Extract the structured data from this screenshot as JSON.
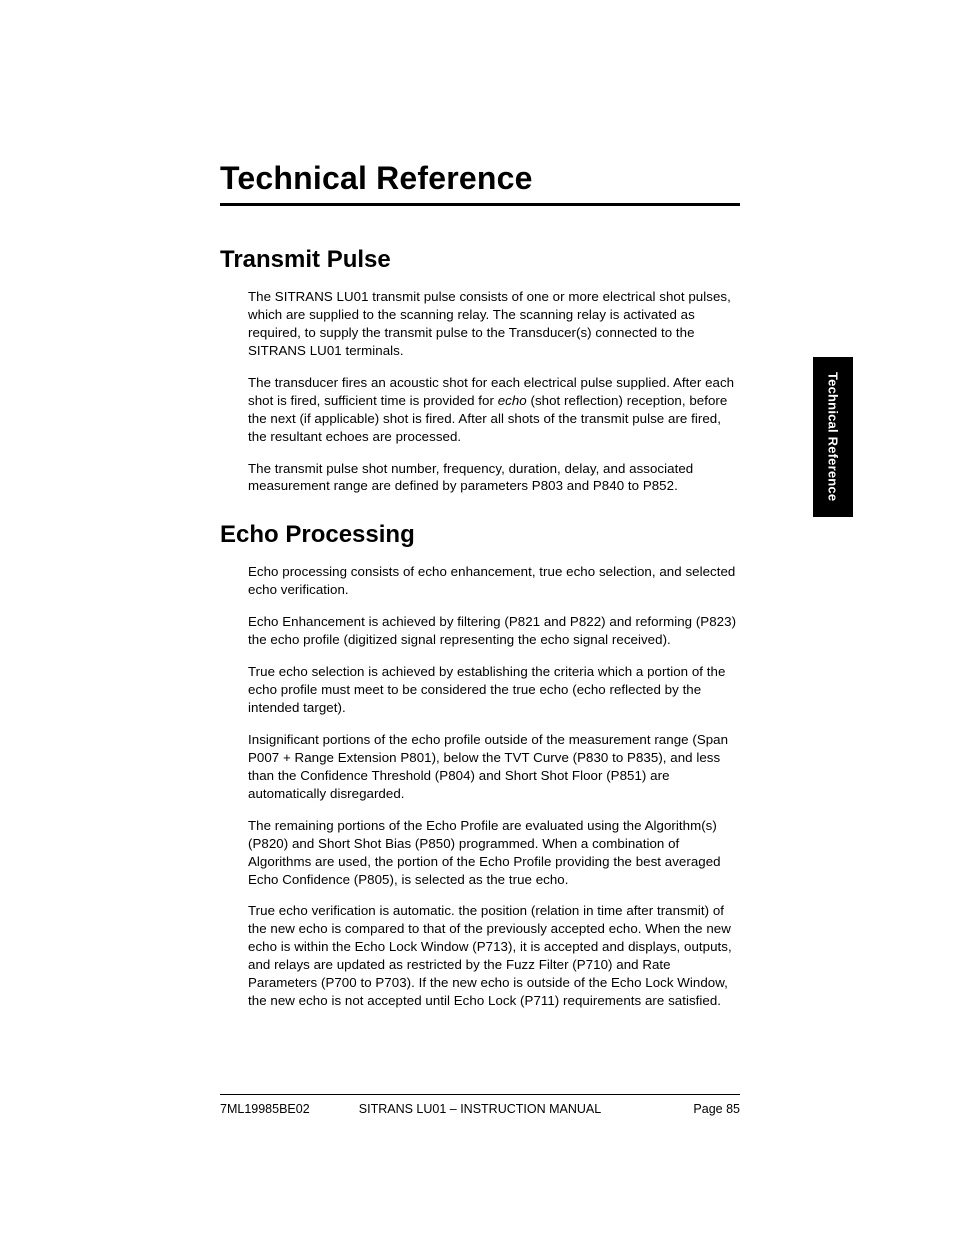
{
  "chapter_title": "Technical Reference",
  "side_tab": "Technical Reference",
  "sections": {
    "transmit_pulse": {
      "title": "Transmit Pulse",
      "p1": "The SITRANS LU01 transmit pulse consists of one or more electrical shot pulses, which are supplied to the scanning relay. The scanning relay is activated as required, to supply the transmit pulse to the Transducer(s) connected to the SITRANS LU01 terminals.",
      "p2_a": "The transducer fires an acoustic shot for each electrical pulse supplied. After each shot is fired, sufficient time is provided for ",
      "p2_echo": "echo",
      "p2_b": " (shot reflection) reception, before the next (if applicable) shot is fired. After all shots of the transmit pulse are fired, the resultant echoes are processed.",
      "p3": "The transmit pulse shot number, frequency, duration, delay, and associated measurement range are defined by parameters P803 and P840 to P852."
    },
    "echo_processing": {
      "title": "Echo Processing",
      "p1": "Echo processing consists of echo enhancement, true echo selection, and selected echo verification.",
      "p2": "Echo Enhancement is achieved by filtering (P821 and P822) and reforming (P823) the echo profile (digitized signal representing the echo signal received).",
      "p3": "True echo selection is achieved by establishing the criteria which a portion of the echo profile must meet to be considered the true echo (echo reflected by the intended target).",
      "p4": "Insignificant portions of the echo profile outside of the measurement range (Span P007 + Range Extension P801), below the TVT Curve (P830 to P835), and less than the Confidence Threshold (P804) and Short Shot Floor (P851) are automatically disregarded.",
      "p5": "The remaining portions of the Echo Profile are evaluated using the Algorithm(s) (P820) and Short Shot Bias (P850) programmed. When a combination of Algorithms are used, the portion of the Echo Profile providing the best averaged Echo Confidence (P805), is selected as the true echo.",
      "p6": "True echo verification is automatic. the position (relation in time after transmit) of the new echo is compared to that of the previously accepted echo. When the new echo is within the Echo Lock Window (P713), it is accepted and displays, outputs, and relays are updated as restricted by the Fuzz Filter (P710) and Rate Parameters (P700 to P703). If the new echo is outside of the Echo Lock Window, the new echo is not accepted until Echo Lock (P711) requirements are satisfied."
    }
  },
  "footer": {
    "left": "7ML19985BE02",
    "center": "SITRANS LU01 – INSTRUCTION MANUAL",
    "right": "Page 85"
  }
}
